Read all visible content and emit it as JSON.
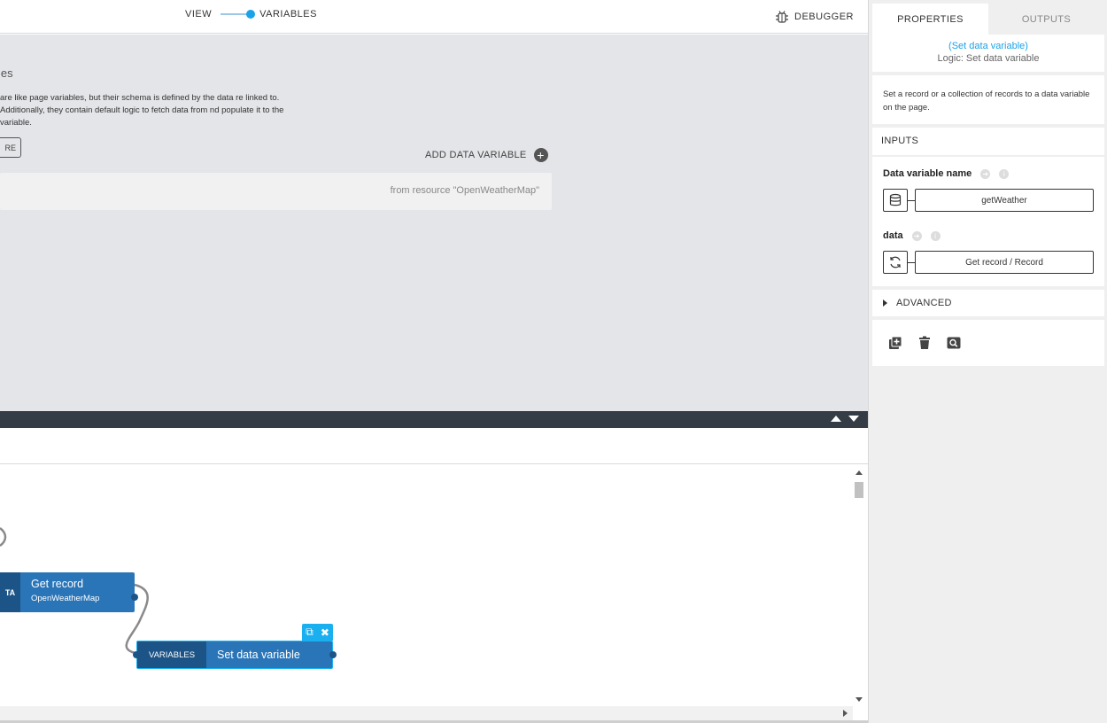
{
  "topbar": {
    "view_label": "VIEW",
    "variables_label": "VARIABLES",
    "debugger_label": "DEBUGGER"
  },
  "canvas": {
    "heading": "les",
    "description": "are like page variables, but their schema is defined by the data re linked to. Additionally, they contain default logic to fetch data from nd populate it to the variable.",
    "more_label": "RE",
    "add_data_variable_label": "ADD DATA VARIABLE",
    "variable_row_source": "from resource \"OpenWeatherMap\""
  },
  "logic": {
    "get_block": {
      "tag": "TA",
      "title": "Get record",
      "subtitle": "OpenWeatherMap"
    },
    "set_block": {
      "tag": "VARIABLES",
      "title": "Set data variable"
    }
  },
  "panel": {
    "tabs": [
      "PROPERTIES",
      "OUTPUTS"
    ],
    "title_link": "(Set data variable)",
    "title_sub": "Logic: Set data variable",
    "description": "Set a record or a collection of records to a data variable on the page.",
    "inputs_heading": "INPUTS",
    "fields": [
      {
        "label": "Data variable name",
        "value": "getWeather"
      },
      {
        "label": "data",
        "value": "Get record / Record"
      }
    ],
    "advanced_label": "ADVANCED"
  },
  "icons": {
    "debugger": "bug-icon",
    "add": "plus-circle-icon",
    "duplicate": "duplicate-icon",
    "close": "close-icon",
    "database": "database-icon",
    "refresh": "refresh-icon",
    "arrow_info": "arrow-right-icon",
    "info": "info-icon",
    "add_block": "add-block-icon",
    "trash": "trash-icon",
    "search": "search-icon"
  },
  "colors": {
    "accent": "#1aa3e8",
    "block_blue": "#2a75b8",
    "block_dark": "#1d5488",
    "divider_bar": "#343c46"
  }
}
